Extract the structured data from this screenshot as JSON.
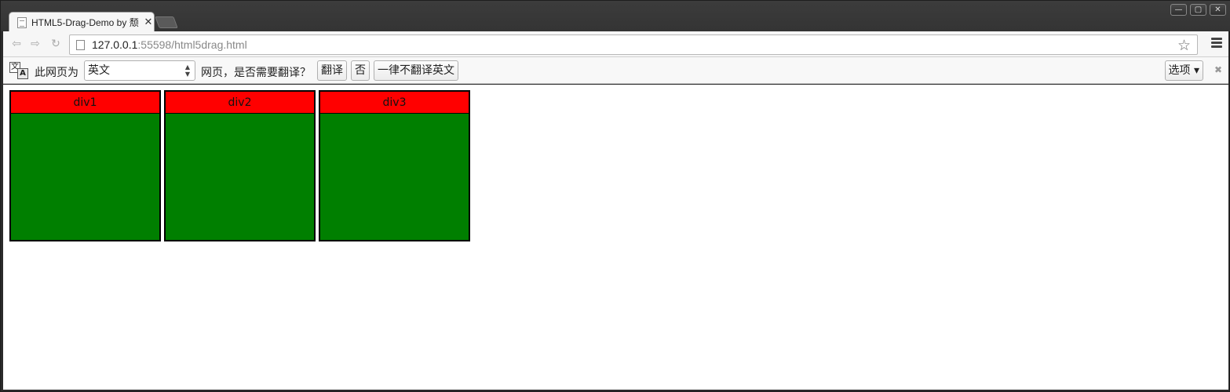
{
  "tab": {
    "title": "HTML5-Drag-Demo by 颓",
    "close": "✕"
  },
  "window_controls": {
    "minimize": "—",
    "maximize": "▢",
    "close": "✕"
  },
  "nav": {
    "back": "⇦",
    "forward": "⇨",
    "reload": "↻"
  },
  "omnibox": {
    "host": "127.0.0.1",
    "rest": ":55598/html5drag.html"
  },
  "translate": {
    "icon_a": "文",
    "icon_b": "A",
    "text_before": "此网页为",
    "language": "英文",
    "text_after": "网页，是否需要翻译？",
    "translate_button": "翻译",
    "no_button": "否",
    "never_button": "一律不翻译英文",
    "options_button": "选项 ▾",
    "close": "✖"
  },
  "boxes": [
    {
      "label": "div1"
    },
    {
      "label": "div2"
    },
    {
      "label": "div3"
    }
  ],
  "colors": {
    "box_header": "#ff0000",
    "box_body": "#007f00"
  }
}
